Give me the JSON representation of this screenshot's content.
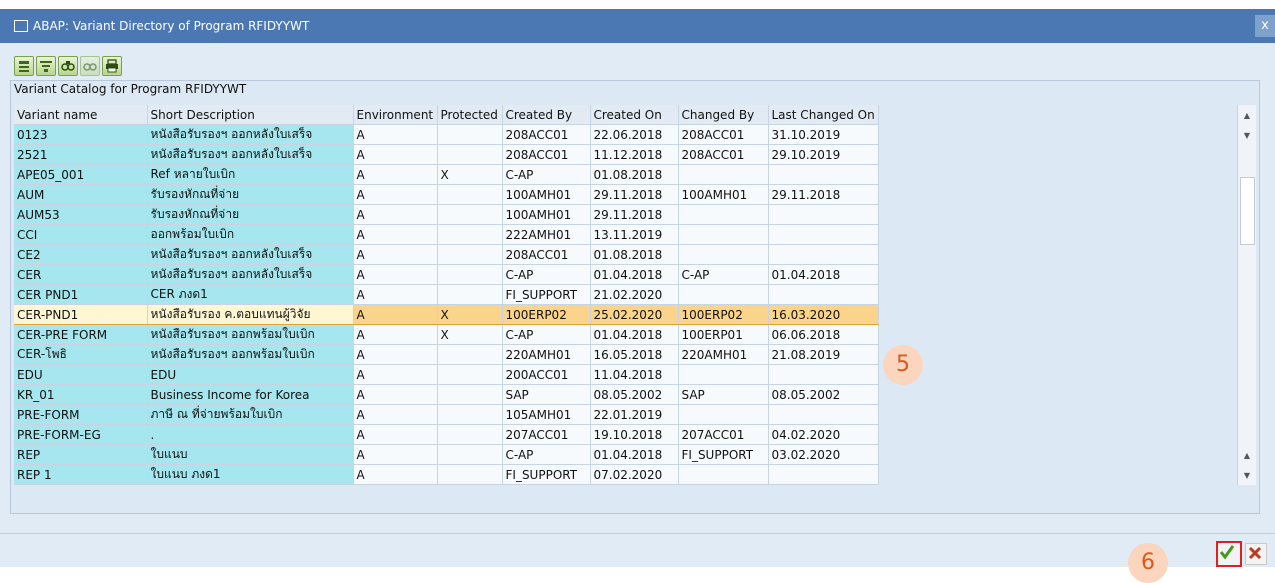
{
  "window": {
    "title": "ABAP: Variant Directory of Program RFIDYYWT",
    "close": "x"
  },
  "catalog_label": "Variant Catalog for Program RFIDYYWT",
  "columns": [
    "Variant name",
    "Short Description",
    "Environment",
    "Protected",
    "Created By",
    "Created On",
    "Changed By",
    "Last Changed On"
  ],
  "rows": [
    [
      "0123",
      "หนังสือรับรองฯ ออกหลังใบเสร็จ",
      "A",
      "",
      "208ACC01",
      "22.06.2018",
      "208ACC01",
      "31.10.2019"
    ],
    [
      "2521",
      "หนังสือรับรองฯ ออกหลังใบเสร็จ",
      "A",
      "",
      "208ACC01",
      "11.12.2018",
      "208ACC01",
      "29.10.2019"
    ],
    [
      "APE05_001",
      "Ref หลายใบเบิก",
      "A",
      "X",
      "C-AP",
      "01.08.2018",
      "",
      ""
    ],
    [
      "AUM",
      "รับรองหักณที่จ่าย",
      "A",
      "",
      "100AMH01",
      "29.11.2018",
      "100AMH01",
      "29.11.2018"
    ],
    [
      "AUM53",
      "รับรองหักณที่จ่าย",
      "A",
      "",
      "100AMH01",
      "29.11.2018",
      "",
      ""
    ],
    [
      "CCI",
      "ออกพร้อมใบเบิก",
      "A",
      "",
      "222AMH01",
      "13.11.2019",
      "",
      ""
    ],
    [
      "CE2",
      "หนังสือรับรองฯ ออกหลังใบเสร็จ",
      "A",
      "",
      "208ACC01",
      "01.08.2018",
      "",
      ""
    ],
    [
      "CER",
      "หนังสือรับรองฯ ออกหลังใบเสร็จ",
      "A",
      "",
      "C-AP",
      "01.04.2018",
      "C-AP",
      "01.04.2018"
    ],
    [
      "CER PND1",
      "CER ภงด1",
      "A",
      "",
      "FI_SUPPORT",
      "21.02.2020",
      "",
      ""
    ],
    [
      "CER-PND1",
      "หนังสือรับรอง ค.ตอบแทนผู้วิจัย",
      "A",
      "X",
      "100ERP02",
      "25.02.2020",
      "100ERP02",
      "16.03.2020"
    ],
    [
      "CER-PRE FORM",
      "หนังสือรับรองฯ ออกพร้อมใบเบิก",
      "A",
      "X",
      "C-AP",
      "01.04.2018",
      "100ERP01",
      "06.06.2018"
    ],
    [
      "CER-โพธิ",
      "หนังสือรับรองฯ ออกพร้อมใบเบิก",
      "A",
      "",
      "220AMH01",
      "16.05.2018",
      "220AMH01",
      "21.08.2019"
    ],
    [
      "EDU",
      "EDU",
      "A",
      "",
      "200ACC01",
      "11.04.2018",
      "",
      ""
    ],
    [
      "KR_01",
      "Business Income for Korea",
      "A",
      "",
      "SAP",
      "08.05.2002",
      "SAP",
      "08.05.2002"
    ],
    [
      "PRE-FORM",
      "ภาษี ณ ที่จ่ายพร้อมใบเบิก",
      "A",
      "",
      "105AMH01",
      "22.01.2019",
      "",
      ""
    ],
    [
      "PRE-FORM-EG",
      ".",
      "A",
      "",
      "207ACC01",
      "19.10.2018",
      "207ACC01",
      "04.02.2020"
    ],
    [
      "REP",
      "ใบแนบ",
      "A",
      "",
      "C-AP",
      "01.04.2018",
      "FI_SUPPORT",
      "03.02.2020"
    ],
    [
      "REP 1",
      "ใบแนบ ภงด1",
      "A",
      "",
      "FI_SUPPORT",
      "07.02.2020",
      "",
      ""
    ]
  ],
  "selected_row_index": 9,
  "callouts": {
    "table": "5",
    "confirm": "6"
  },
  "icons": {
    "toolbar": [
      "select-all-icon",
      "filter-icon",
      "find-icon",
      "find-next-icon",
      "print-icon"
    ],
    "ok": "checkmark-icon",
    "cancel": "cross-icon"
  },
  "colors": {
    "title_bar": "#4b78b3",
    "key_column": "#a6e6ee",
    "selected_row": "#fbd48b",
    "callout": "#fbd5be",
    "callout_text": "#d65a1f"
  }
}
